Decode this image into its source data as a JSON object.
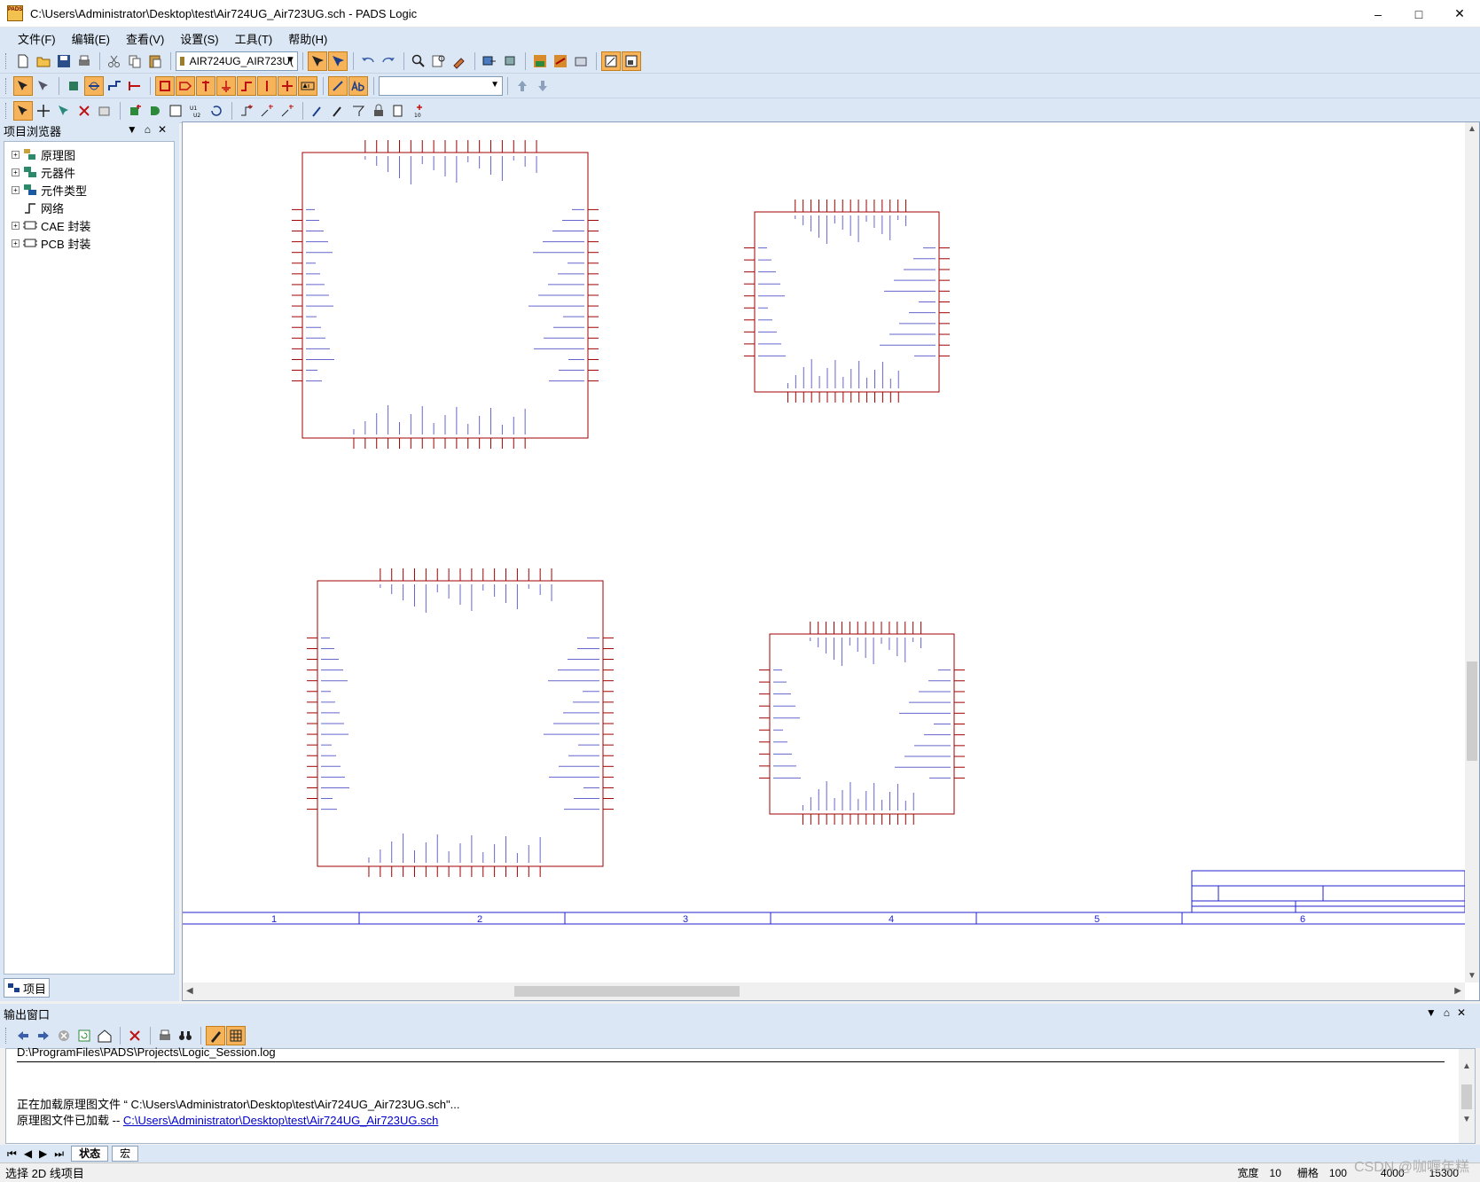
{
  "window": {
    "title": "C:\\Users\\Administrator\\Desktop\\test\\Air724UG_Air723UG.sch - PADS Logic",
    "icon_label": "PADS",
    "controls": [
      "minimize-icon",
      "maximize-icon",
      "close-icon"
    ]
  },
  "menu": [
    "文件(F)",
    "编辑(E)",
    "查看(V)",
    "设置(S)",
    "工具(T)",
    "帮助(H)"
  ],
  "toolbar": {
    "sheet_select": "AIR724UG_AIR723U(",
    "combo2_value": ""
  },
  "browser": {
    "title": "项目浏览器",
    "items": [
      {
        "label": "原理图",
        "expandable": true
      },
      {
        "label": "元器件",
        "expandable": true
      },
      {
        "label": "元件类型",
        "expandable": true
      },
      {
        "label": "网络",
        "expandable": false
      },
      {
        "label": "CAE 封装",
        "expandable": true
      },
      {
        "label": "PCB 封装",
        "expandable": true
      }
    ],
    "tab": "项目"
  },
  "canvas": {
    "zone_labels": [
      "1",
      "2",
      "3",
      "4",
      "5",
      "6"
    ],
    "colors": {
      "component": "#a00000",
      "pin_text": "#0000aa",
      "border": "#2222cc"
    }
  },
  "output": {
    "title": "输出窗口",
    "lines": {
      "cut": "D:\\ProgramFiles\\PADS\\Projects\\Logic_Session.log",
      "loading": "正在加载原理图文件 “ C:\\Users\\Administrator\\Desktop\\test\\Air724UG_Air723UG.sch\"...",
      "loaded_prefix": "原理图文件已加载  -- ",
      "loaded_link": "C:\\Users\\Administrator\\Desktop\\test\\Air724UG_Air723UG.sch"
    },
    "tabs": [
      "状态",
      "宏"
    ]
  },
  "status": {
    "message": "选择 2D 线项目",
    "width_label": "宽度",
    "width_value": "10",
    "grid_label": "栅格",
    "grid_value": "100",
    "x": "4000",
    "y": "15300"
  },
  "watermark": "CSDN @咖喱年糕"
}
